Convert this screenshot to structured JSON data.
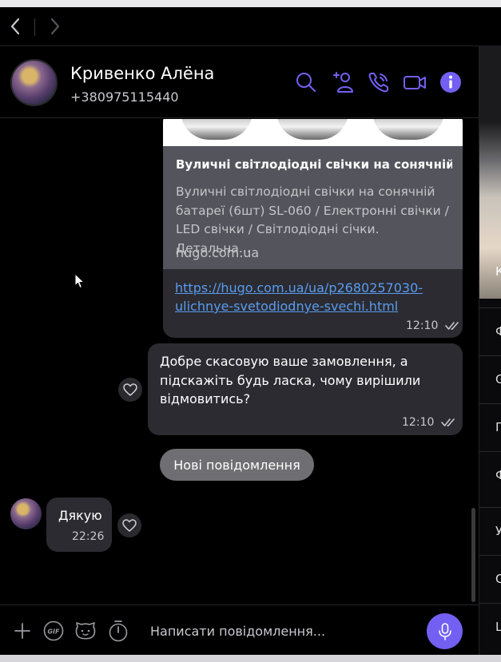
{
  "window": {
    "nav_back_icon": "chevron-left-icon",
    "nav_forward_icon": "chevron-right-icon"
  },
  "header": {
    "contact_name": "Кривенко Алёна",
    "contact_phone": "+380975115440",
    "icons": [
      "search-icon",
      "add-contact-icon",
      "phone-call-icon",
      "video-call-icon",
      "info-icon"
    ]
  },
  "right_panel": {
    "image_letter": "К",
    "items": [
      "Ф",
      "G",
      "П",
      "Ф",
      "У",
      "С",
      "Ц"
    ]
  },
  "chat": {
    "link_card": {
      "title": "Вуличні світлодіодні свічки на сонячній...",
      "description": "Вуличні світлодіодні свічки на сонячній батареї (6шт) SL-060 / Електронні свічки / LED свічки / Світлодіодні січки. Детальна...",
      "domain": "hugo.com.ua",
      "url": "https://hugo.com.ua/ua/p2680257030-ulichnye-svetodiodnye-svechi.html",
      "time": "12:10",
      "status": "read"
    },
    "outgoing_message": {
      "text": "Добре скасовую ваше замовлення, а підскажіть будь ласка, чому вирішили відмовитись?",
      "time": "12:10",
      "status": "read"
    },
    "new_messages_label": "Нові повідомлення",
    "incoming_message": {
      "text": "Дякую",
      "time": "22:26"
    }
  },
  "composer": {
    "placeholder": "Написати повідомлення...",
    "icons": [
      "plus-icon",
      "gif-icon",
      "sticker-icon",
      "timer-icon",
      "microphone-icon"
    ]
  },
  "colors": {
    "accent": "#7360f2",
    "bubble": "#2b2b31",
    "link": "#5a9cf0",
    "background": "#000000"
  }
}
